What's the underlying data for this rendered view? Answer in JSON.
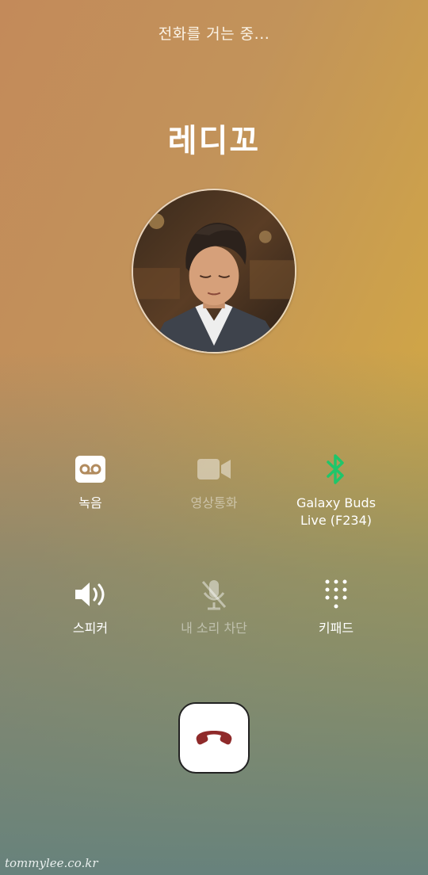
{
  "call": {
    "status": "전화를 거는 중...",
    "contact_name": "레디꼬"
  },
  "actions": [
    {
      "label": "녹음",
      "icon": "voicemail-icon",
      "enabled": true
    },
    {
      "label": "영상통화",
      "icon": "video-call-icon",
      "enabled": false
    },
    {
      "label": "Galaxy Buds\nLive (F234)",
      "icon": "bluetooth-icon",
      "enabled": true
    },
    {
      "label": "스피커",
      "icon": "speaker-icon",
      "enabled": true
    },
    {
      "label": "내 소리 차단",
      "icon": "mute-mic-icon",
      "enabled": false
    },
    {
      "label": "키패드",
      "icon": "keypad-icon",
      "enabled": true
    }
  ],
  "end_call": {
    "icon": "end-call-icon"
  },
  "colors": {
    "bluetooth": "#1fc66a",
    "end_call": "#8f2a2a"
  },
  "watermark": "tommylee.co.kr"
}
